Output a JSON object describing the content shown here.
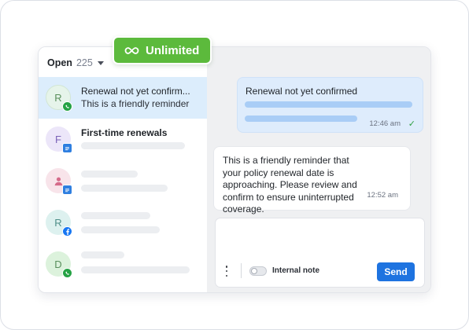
{
  "badge_pill": {
    "label": "Unlimited",
    "icon": "infinity-icon",
    "color": "#5cba3c"
  },
  "list": {
    "filter_label": "Open",
    "count": "225",
    "items": [
      {
        "avatar": "R",
        "channel": "whatsapp-icon",
        "title": "Renewal not yet confirm...",
        "preview": "This is a friendly reminder",
        "active": true
      },
      {
        "avatar": "F",
        "channel": "sms-icon",
        "title": "First-time renewals",
        "preview": ""
      },
      {
        "avatar": "",
        "channel": "sms-icon",
        "title": "",
        "preview": ""
      },
      {
        "avatar": "R",
        "channel": "facebook-icon",
        "title": "",
        "preview": ""
      },
      {
        "avatar": "D",
        "channel": "whatsapp-icon",
        "title": "",
        "preview": ""
      }
    ]
  },
  "chat": {
    "outgoing": {
      "text": "Renewal not yet confirmed",
      "time": "12:46 am"
    },
    "incoming": {
      "text": "This is a friendly reminder that your policy renewal date is approaching. Please review and confirm to ensure uninterrupted coverage.",
      "time": "12:52 am"
    },
    "composer": {
      "toggle_label": "Internal note",
      "send_label": "Send"
    }
  },
  "colors": {
    "accent": "#1e73e0",
    "active_row": "#dcedfc",
    "whatsapp": "#25a244",
    "facebook": "#1877f2"
  }
}
